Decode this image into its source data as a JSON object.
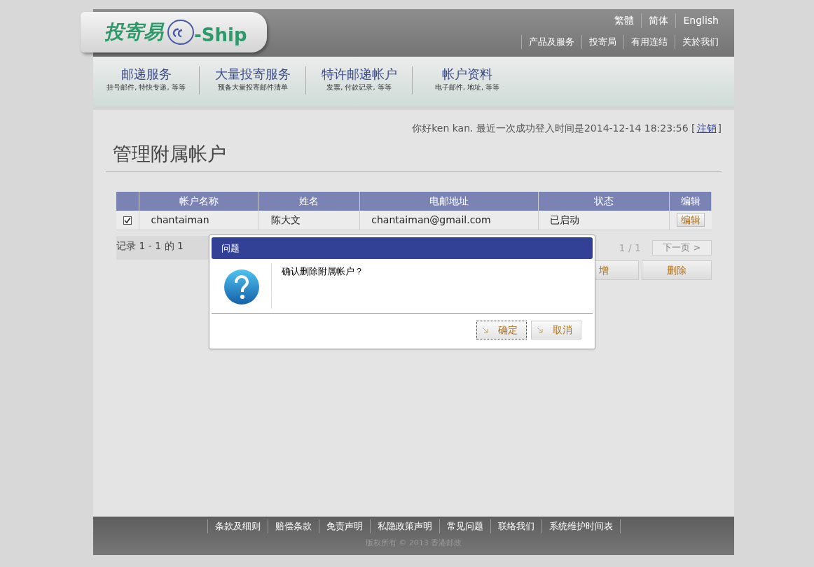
{
  "header": {
    "logo_text": "投寄易",
    "logo_brand": "-Ship",
    "languages": [
      "繁體",
      "简体",
      "English"
    ],
    "links": [
      "产品及服务",
      "投寄局",
      "有用连结",
      "关於我们"
    ]
  },
  "nav": [
    {
      "title": "邮递服务",
      "subtitle": "挂号邮件, 特快专递, 等等"
    },
    {
      "title": "大量投寄服务",
      "subtitle": "预备大量投寄邮件清单"
    },
    {
      "title": "特许邮递帐户",
      "subtitle": "发票, 付款记录, 等等"
    },
    {
      "title": "帐户资料",
      "subtitle": "电子邮件, 地址, 等等"
    }
  ],
  "greeting": {
    "text": "你好ken kan. 最近一次成功登入时间是2014-12-14 18:23:56 [",
    "logout": "注销",
    "close": "]"
  },
  "page_title": "管理附属帐户",
  "table": {
    "columns": [
      "帐户名称",
      "姓名",
      "电邮地址",
      "状态",
      "编辑"
    ],
    "rows": [
      {
        "checked": true,
        "cells": [
          "chantaiman",
          "陈大文",
          "chantaiman@gmail.com",
          "已启动"
        ],
        "edit": "编辑"
      }
    ]
  },
  "records": "记录 1 - 1 的 1",
  "pager": "1 / 1",
  "next": "下一页 >",
  "actions": [
    "增",
    "删除"
  ],
  "dialog": {
    "title": "问题",
    "message": "确认删除附属帐户？",
    "buttons": [
      {
        "label": "确定",
        "focused": true
      },
      {
        "label": "取消",
        "focused": false
      }
    ]
  },
  "footer": {
    "links": [
      "条款及细则",
      "赔偿条款",
      "免责声明",
      "私隐政策声明",
      "常见问题",
      "联络我们",
      "系统维护时间表"
    ],
    "copyright": "版权所有 © 2013 香港邮政"
  }
}
